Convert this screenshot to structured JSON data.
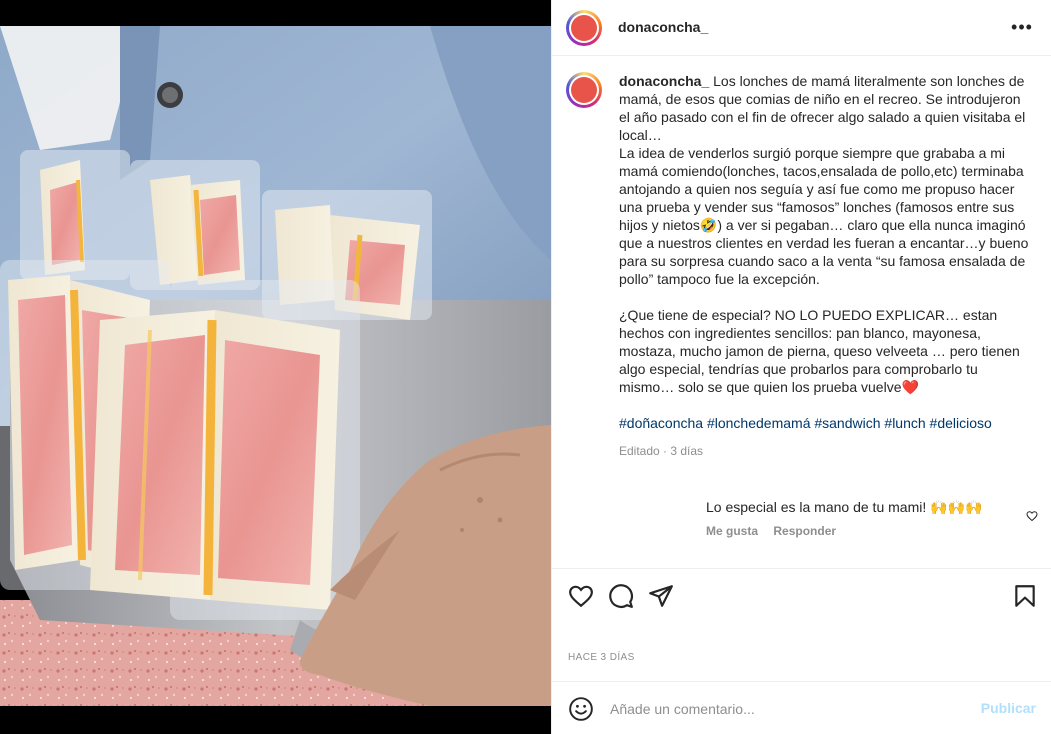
{
  "post": {
    "username": "donaconcha_",
    "more_icon": "more-horizontal-icon",
    "photo_alt": "sandwiches-on-tray-photo",
    "caption": {
      "username": "donaconcha_",
      "text": "Los lonches de mamá literalmente son lonches de mamá, de esos que comias de niño en el recreo. Se introdujeron el año pasado con el fin de ofrecer algo salado a quien visitaba el local…\nLa idea de venderlos surgió porque siempre que grababa a mi mamá comiendo(lonches, tacos,ensalada de pollo,etc) terminaba antojando a quien nos seguía y así fue como me propuso hacer una prueba y vender sus “famosos” lonches (famosos entre sus hijos y nietos🤣) a ver si pegaban… claro que ella nunca imaginó que a nuestros clientes en verdad les fueran a encantar…y bueno para su sorpresa cuando saco a la venta “su famosa ensalada de pollo” tampoco fue la excepción.\n\n¿Que tiene de especial? NO LO PUEDO EXPLICAR… estan hechos con ingredientes sencillos: pan blanco, mayonesa, mostaza, mucho jamon de pierna, queso velveeta … pero tienen algo especial, tendrías que probarlos para comprobarlo tu mismo… solo se que quien los prueba vuelve❤️",
      "hashtags": "#doñaconcha #lonchedemamá #sandwich #lunch #delicioso",
      "meta": "Editado · 3 días"
    },
    "comment": {
      "text": "Lo especial es la mano de tu mami! 🙌🙌🙌",
      "like_label": "Me gusta",
      "reply_label": "Responder",
      "heart_icon": "heart-icon"
    },
    "actions": {
      "like_icon": "heart-icon",
      "comment_icon": "comment-bubble-icon",
      "share_icon": "paper-plane-icon",
      "save_icon": "bookmark-icon"
    },
    "timestamp": "HACE 3 DÍAS",
    "add_comment": {
      "emoji_icon": "emoji-icon",
      "placeholder": "Añade un comentario...",
      "publish_label": "Publicar"
    }
  },
  "colors": {
    "link": "#00376b",
    "muted": "#8e8e8e",
    "publish_disabled": "#b2dffc"
  }
}
